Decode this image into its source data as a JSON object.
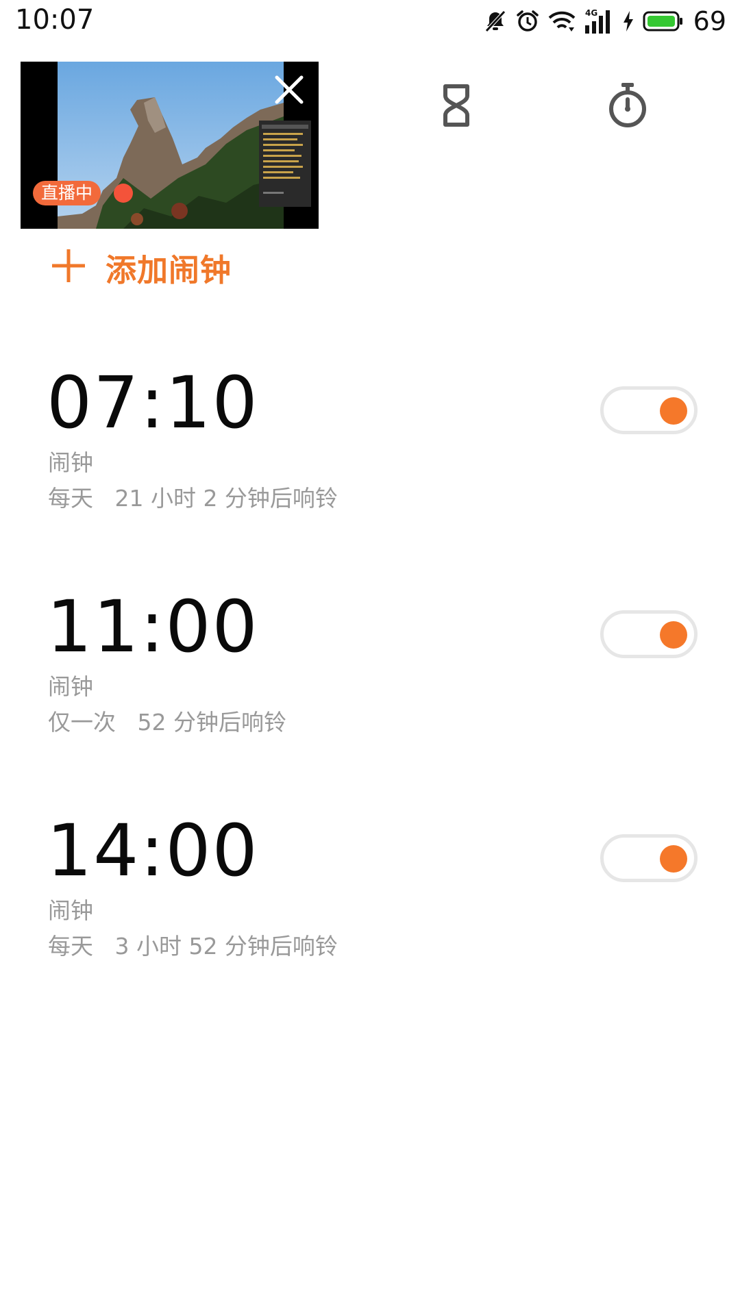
{
  "status_bar": {
    "time": "10:07",
    "battery_level": "69",
    "icons": [
      "bell-muted-icon",
      "alarm-clock-icon",
      "wifi-icon",
      "signal-4g-icon",
      "charging-icon",
      "battery-icon"
    ]
  },
  "live_video": {
    "badge": "直播中",
    "close_icon": "close-icon"
  },
  "tabs": [
    {
      "icon": "hourglass-icon"
    },
    {
      "icon": "stopwatch-icon"
    }
  ],
  "add_alarm": {
    "label": "添加闹钟",
    "icon": "plus-icon"
  },
  "alarms": [
    {
      "time": "07:10",
      "label": "闹钟",
      "description": "每天   21 小时 2 分钟后响铃",
      "enabled": true
    },
    {
      "time": "11:00",
      "label": "闹钟",
      "description": "仅一次   52 分钟后响铃",
      "enabled": true
    },
    {
      "time": "14:00",
      "label": "闹钟",
      "description": "每天   3 小时 52 分钟后响铃",
      "enabled": true
    }
  ],
  "colors": {
    "accent": "#f5782a",
    "secondary_text": "#999999",
    "live_badge": "#f26a3b"
  }
}
